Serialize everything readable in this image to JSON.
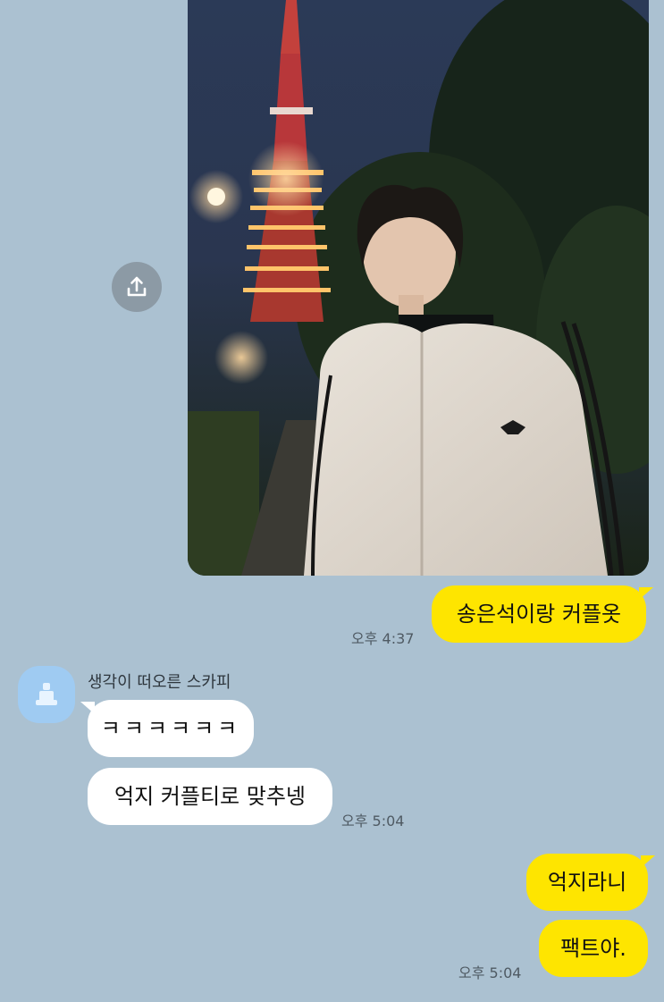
{
  "chat": {
    "messages": {
      "photo": {
        "time": ""
      },
      "m1": {
        "text": "송은석이랑 커플옷",
        "time": "오후 4:37"
      },
      "sender": {
        "name": "생각이 떠오른 스카피"
      },
      "m2": {
        "text": "ㅋㅋㅋㅋㅋㅋ"
      },
      "m3": {
        "text": "억지 커플티로 맞추넹",
        "time": "오후 5:04"
      },
      "m4": {
        "text": "억지라니"
      },
      "m5": {
        "text": "팩트야.",
        "time": "오후 5:04"
      }
    }
  },
  "icons": {
    "share": "share-upload-icon",
    "avatar": "default-profile-icon"
  },
  "colors": {
    "background": "#abc1d1",
    "sent_bubble": "#fee500",
    "received_bubble": "#ffffff",
    "avatar": "#9fcbf2",
    "share_button": "#8c9aa5"
  }
}
